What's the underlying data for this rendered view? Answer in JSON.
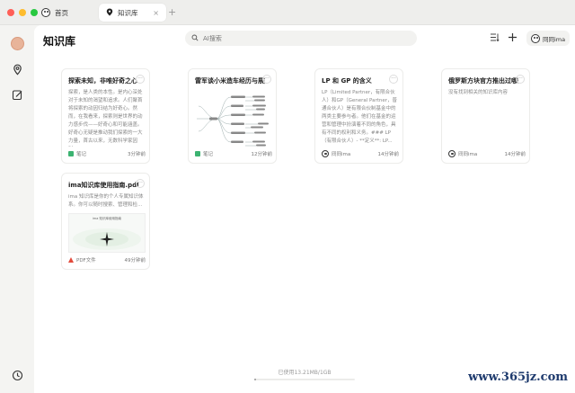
{
  "window": {
    "tabs": [
      {
        "label": "首页"
      },
      {
        "label": "知识库",
        "close": "×"
      }
    ],
    "new_tab": "+"
  },
  "page": {
    "title": "知识库",
    "search_placeholder": "AI搜索",
    "owner_label": "冏冏ima"
  },
  "cards": [
    {
      "title": "探索未知，非唯好奇之心",
      "body": "探索，是人类的本性。是内心深处对于未知的渴望和追求。人们聚首将探索的动因归结为好奇心。然而，在我看来，探索则是世界的动力感步伐——好奇心和可能涵盖。好奇心无疑是推动我们探索的一大力量，首古以来，无数科学家因对...",
      "type": "笔记",
      "time": "3分钟前"
    },
    {
      "title": "雷军谈小米造车经历与展望",
      "type": "笔记",
      "time": "12分钟前"
    },
    {
      "title": "LP 和 GP 的含义",
      "body": "LP（Limited Partner，有限合伙人）和GP（General Partner，普通合伙人）是有限合伙制基金中的两类主要参与者。他们在基金的运营和管理中扮演着不同的角色，具有不同的权利和义务。### LP（有限合伙人）- **定义**: LP...",
      "type": "冏冏ima",
      "time": "14分钟前"
    },
    {
      "title": "俄罗斯方块官方推出过哪些...",
      "body": "没有找到相关的知识库内容",
      "type": "冏冏ima",
      "time": "14分钟前"
    },
    {
      "title": "ima知识库使用指南.pdf",
      "body": "ima 知识库是你的个人专属知识体系。你可以随时搜索、管理和检...",
      "thumb_title": "ima 知识库使用指南",
      "type": "PDF文件",
      "time": "49分钟前"
    }
  ],
  "storage": {
    "label": "已使用13.21MB/1GB",
    "used_fraction": 0.013
  },
  "watermark": "www.365jz.com"
}
